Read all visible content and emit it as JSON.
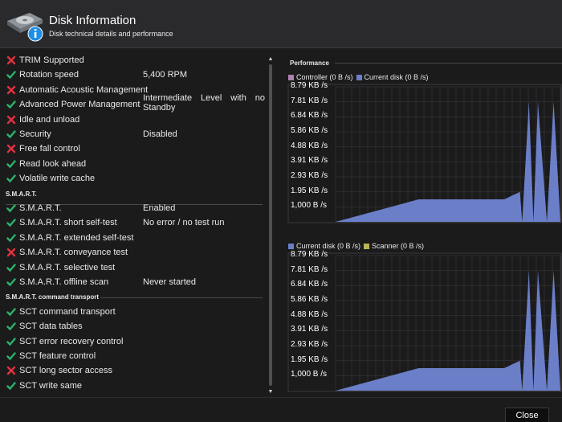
{
  "header": {
    "title": "Disk Information",
    "subtitle": "Disk technical details and performance",
    "icon": "disk-info-icon"
  },
  "features": [
    {
      "name": "TRIM Supported",
      "status": "unsupported",
      "value": ""
    },
    {
      "name": "Rotation speed",
      "status": "supported",
      "value": "5,400 RPM"
    },
    {
      "name": "Automatic Acoustic Management",
      "status": "unsupported",
      "value": ""
    },
    {
      "name": "Advanced Power Management",
      "status": "supported",
      "value": "Intermediate Level with no Standby",
      "value_line1": "Intermediate Level with no",
      "value_line2": "Standby"
    },
    {
      "name": "Idle and unload",
      "status": "unsupported",
      "value": ""
    },
    {
      "name": "Security",
      "status": "supported",
      "value": "Disabled"
    },
    {
      "name": "Free fall control",
      "status": "unsupported",
      "value": ""
    },
    {
      "name": "Read look ahead",
      "status": "supported",
      "value": ""
    },
    {
      "name": "Volatile write cache",
      "status": "supported",
      "value": ""
    }
  ],
  "smart": {
    "title": "S.M.A.R.T.",
    "items": [
      {
        "name": "S.M.A.R.T.",
        "status": "supported",
        "value": "Enabled"
      },
      {
        "name": "S.M.A.R.T. short self-test",
        "status": "supported",
        "value": "No error / no test run"
      },
      {
        "name": "S.M.A.R.T. extended self-test",
        "status": "supported",
        "value": ""
      },
      {
        "name": "S.M.A.R.T. conveyance test",
        "status": "unsupported",
        "value": ""
      },
      {
        "name": "S.M.A.R.T. selective test",
        "status": "supported",
        "value": ""
      },
      {
        "name": "S.M.A.R.T. offline scan",
        "status": "supported",
        "value": "Never started"
      }
    ]
  },
  "sct": {
    "title": "S.M.A.R.T. command transport",
    "items": [
      {
        "name": "SCT command transport",
        "status": "supported",
        "value": ""
      },
      {
        "name": "SCT data tables",
        "status": "supported",
        "value": ""
      },
      {
        "name": "SCT error recovery control",
        "status": "supported",
        "value": ""
      },
      {
        "name": "SCT feature control",
        "status": "supported",
        "value": ""
      },
      {
        "name": "SCT long sector access",
        "status": "unsupported",
        "value": ""
      },
      {
        "name": "SCT write same",
        "status": "supported",
        "value": ""
      }
    ]
  },
  "colors": {
    "check": "#2db36b",
    "cross": "#e0333f",
    "area_fill": "#6b7fc9",
    "controller": "#b07fb0",
    "current_disk": "#6b7fc9",
    "scanner": "#b7b556"
  },
  "performance": {
    "title": "Performance",
    "y_ticks": [
      "8.79 KB /s",
      "7.81 KB /s",
      "6.84 KB /s",
      "5.86 KB /s",
      "4.88 KB /s",
      "3.91 KB /s",
      "2.93 KB /s",
      "1.95 KB /s",
      "1,000 B /s"
    ]
  },
  "chart_data": [
    {
      "type": "area",
      "legend": [
        {
          "name": "Controller (0 B /s)",
          "color": "#b07fb0"
        },
        {
          "name": "Current disk (0 B /s)",
          "color": "#6b7fc9"
        }
      ],
      "y_ticks": [
        "8.79 KB /s",
        "7.81 KB /s",
        "6.84 KB /s",
        "5.86 KB /s",
        "4.88 KB /s",
        "3.91 KB /s",
        "2.93 KB /s",
        "1.95 KB /s",
        "1,000 B /s"
      ],
      "ylim": [
        0,
        9000
      ],
      "grid": true,
      "series": [
        {
          "name": "Current disk (0 B /s)",
          "values": [
            0,
            1500,
            1500,
            2000,
            0,
            8000,
            0,
            8000,
            0,
            8000,
            0
          ],
          "x": [
            0,
            37,
            75,
            82,
            83,
            86,
            88,
            90,
            94,
            97,
            100
          ]
        }
      ]
    },
    {
      "type": "area",
      "legend": [
        {
          "name": "Current disk (0 B /s)",
          "color": "#6b7fc9"
        },
        {
          "name": "Scanner (0 B /s)",
          "color": "#b7b556"
        }
      ],
      "y_ticks": [
        "8.79 KB /s",
        "7.81 KB /s",
        "6.84 KB /s",
        "5.86 KB /s",
        "4.88 KB /s",
        "3.91 KB /s",
        "2.93 KB /s",
        "1.95 KB /s",
        "1,000 B /s"
      ],
      "ylim": [
        0,
        9000
      ],
      "grid": true,
      "series": [
        {
          "name": "Current disk (0 B /s)",
          "values": [
            0,
            1500,
            1500,
            2000,
            0,
            8000,
            0,
            8000,
            0,
            8000,
            0
          ],
          "x": [
            0,
            37,
            75,
            82,
            83,
            86,
            88,
            90,
            94,
            97,
            100
          ]
        }
      ]
    }
  ],
  "footer": {
    "close_label": "Close"
  }
}
